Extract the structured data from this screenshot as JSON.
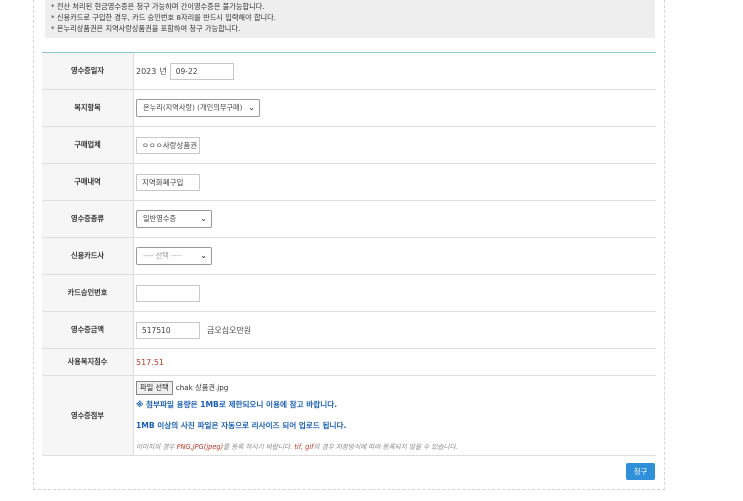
{
  "notice": {
    "lines": [
      "* 전산 처리된 현금영수증은 청구 가능하며 간이영수증은 불가능합니다.",
      "* 신용카드로 구입한 경우, 카드 승인번호 8자리를 반드시 입력해야 합니다.",
      "* 온누리상품권은 지역사랑상품권을 포함하여 청구 가능합니다."
    ]
  },
  "form": {
    "receipt_date": {
      "label": "영수증일자",
      "year": "2023",
      "year_unit": "년",
      "date_value": "09-22"
    },
    "welfare_item": {
      "label": "복지항목",
      "selected": "온누리(지역사랑) (개인의무구매)"
    },
    "vendor": {
      "label": "구매업체",
      "value": "ㅇㅇㅇ사랑상품권"
    },
    "purchase_detail": {
      "label": "구매내역",
      "value": "지역화폐구입"
    },
    "receipt_type": {
      "label": "영수증종류",
      "selected": "일반영수증"
    },
    "card_company": {
      "label": "신용카드사",
      "selected": "---- 선택 ----"
    },
    "card_approval": {
      "label": "카드승인번호",
      "value": ""
    },
    "receipt_amount": {
      "label": "영수증금액",
      "value": "517510",
      "amount_text": "금오십오만원"
    },
    "used_points": {
      "label": "사용복지점수",
      "value": "517.51"
    },
    "attachment": {
      "label": "영수증첨부",
      "file_button": "파일 선택",
      "file_name": "chak 상품권.jpg",
      "note1": "※ 첨부파일 용량은 1MB로 제한되오니 이용에 참고 바랍니다.",
      "note2": "1MB 이상의 사진 파일은 자동으로 리사이즈 되어 업로드 됩니다.",
      "hint_prefix": "이미지의 경우",
      "hint_png": "PNG,JPG(jpeg)",
      "hint_mid": "를 등록 하시기 바랍니다.",
      "hint_tif": "tif, gif",
      "hint_suffix": "의 경우 저장방식에 따라 등록되지 않을 수 있습니다."
    }
  },
  "submit_label": "청구",
  "colors": {
    "accent_blue": "#2f8fd8",
    "points_red": "#c0392b"
  }
}
